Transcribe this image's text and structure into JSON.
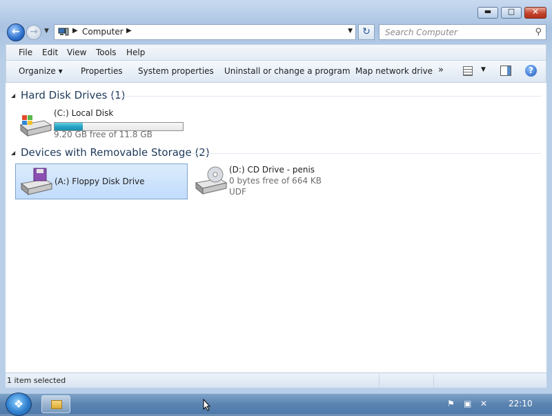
{
  "window": {
    "controls": {
      "minimize": "▬",
      "maximize": "□",
      "close": "✕"
    }
  },
  "nav": {
    "back_icon": "arrow-left-icon",
    "forward_icon": "arrow-right-icon",
    "address": {
      "crumbs": [
        "Computer"
      ],
      "separator": "▶"
    },
    "search_placeholder": "Search Computer"
  },
  "menu": {
    "items": [
      "File",
      "Edit",
      "View",
      "Tools",
      "Help"
    ]
  },
  "commands": {
    "items": [
      "Organize ▾",
      "Properties",
      "System properties",
      "Uninstall or change a program",
      "Map network drive"
    ],
    "more": "»"
  },
  "groups": [
    {
      "title": "Hard Disk Drives (1)",
      "drives": [
        {
          "name": "(C:) Local Disk",
          "detail": "9.20 GB free of 11.8 GB",
          "used_fraction": 0.22,
          "icon": "hard-disk-icon"
        }
      ]
    },
    {
      "title": "Devices with Removable Storage (2)",
      "drives": [
        {
          "name": "(A:) Floppy Disk Drive",
          "icon": "floppy-drive-icon",
          "selected": true
        },
        {
          "name": "(D:) CD Drive - penis",
          "detail": "0 bytes free of 664 KB",
          "detail2": "UDF",
          "icon": "cd-drive-icon"
        }
      ]
    }
  ],
  "status": {
    "text": "1 item selected"
  },
  "taskbar": {
    "clock": "22:10",
    "start_icon": "windows-start-icon"
  },
  "colors": {
    "accent": "#2b6fcc",
    "selection": "#c1dcfc",
    "progress": "#27a3c4"
  }
}
